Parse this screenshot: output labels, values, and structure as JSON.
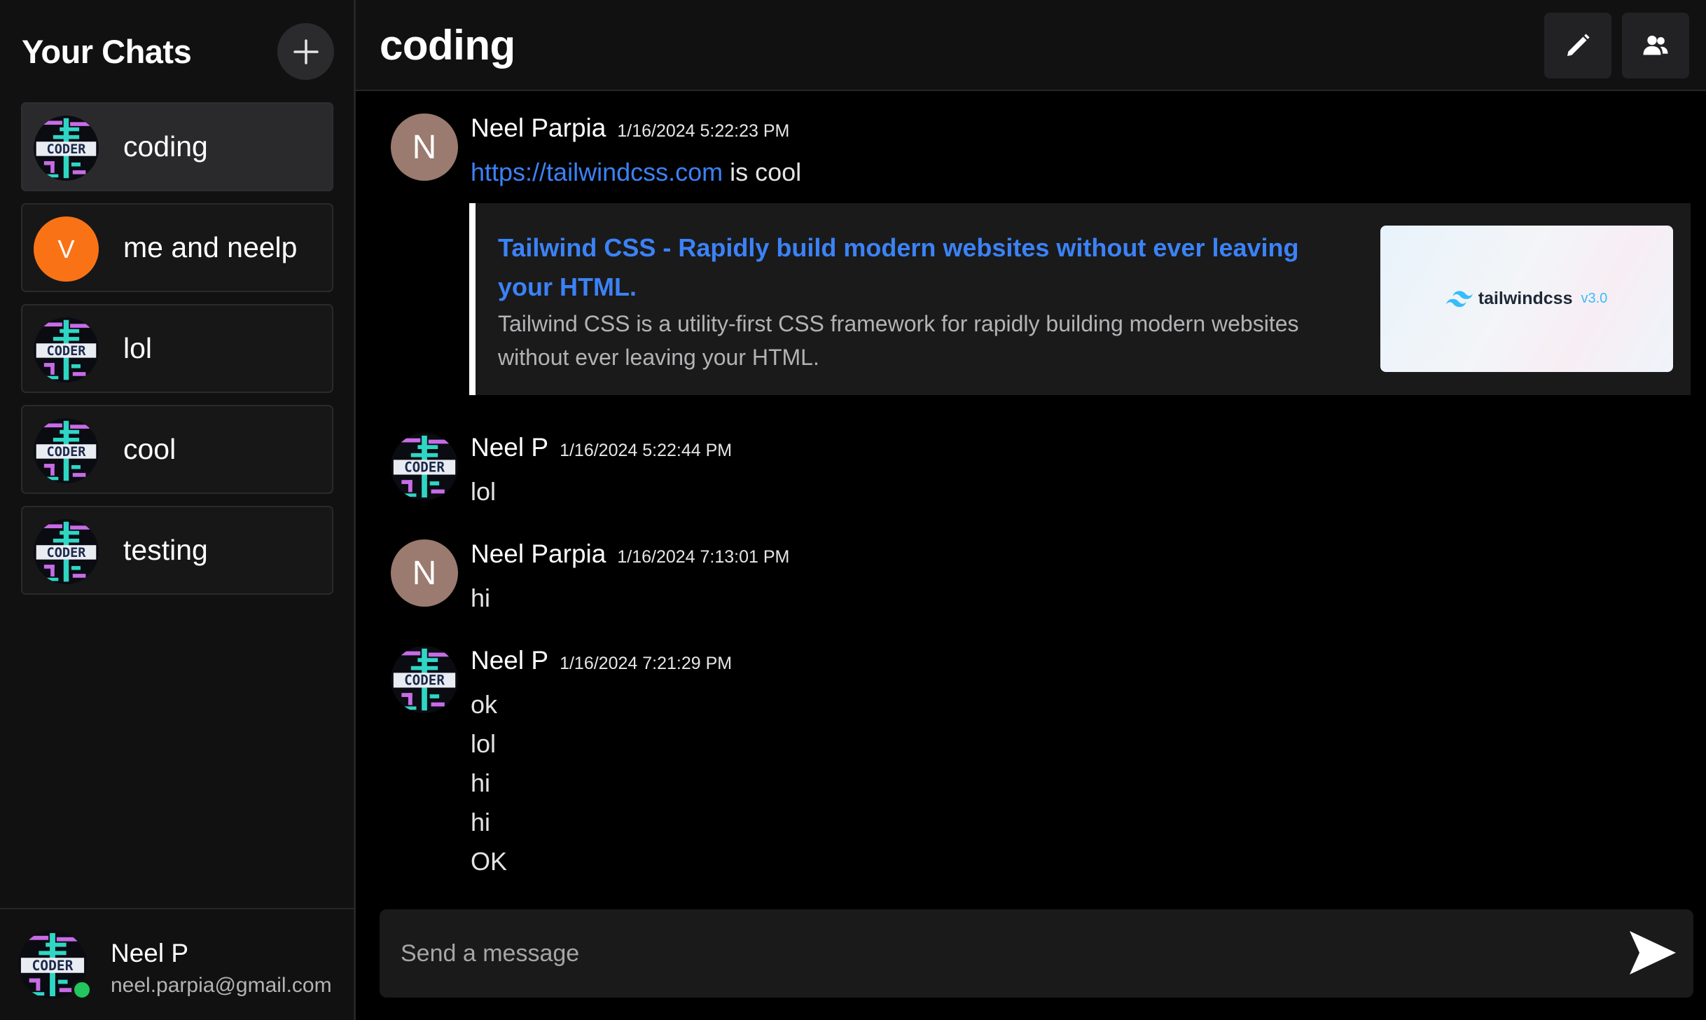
{
  "sidebar": {
    "title": "Your Chats",
    "new_chat_icon": "plus-icon",
    "chats": [
      {
        "name": "coding",
        "avatar": "coder-image",
        "active": true
      },
      {
        "name": "me and neelp",
        "avatar_letter": "V",
        "avatar_color": "#f97316"
      },
      {
        "name": "lol",
        "avatar": "coder-image"
      },
      {
        "name": "cool",
        "avatar": "coder-image"
      },
      {
        "name": "testing",
        "avatar": "coder-image"
      }
    ],
    "user": {
      "name": "Neel P",
      "email": "neel.parpia@gmail.com",
      "status_color": "#22c55e"
    }
  },
  "header": {
    "title": "coding",
    "edit_icon": "pencil-icon",
    "members_icon": "users-icon"
  },
  "messages": [
    {
      "author": "Neel Parpia",
      "avatar_letter": "N",
      "avatar_color": "#9b7a70",
      "timestamp": "1/16/2024 5:22:23 PM",
      "link_text": "https://tailwindcss.com",
      "text_after_link": " is cool",
      "embed": {
        "title": "Tailwind CSS - Rapidly build modern websites without ever leaving your HTML.",
        "description": "Tailwind CSS is a utility-first CSS framework for rapidly building modern websites without ever leaving your HTML.",
        "thumbnail_brand": "tailwindcss",
        "thumbnail_version": "v3.0"
      }
    },
    {
      "author": "Neel P",
      "avatar": "coder-image",
      "timestamp": "1/16/2024 5:22:44 PM",
      "lines": [
        "lol"
      ]
    },
    {
      "author": "Neel Parpia",
      "avatar_letter": "N",
      "avatar_color": "#9b7a70",
      "timestamp": "1/16/2024 7:13:01 PM",
      "lines": [
        "hi"
      ]
    },
    {
      "author": "Neel P",
      "avatar": "coder-image",
      "timestamp": "1/16/2024 7:21:29 PM",
      "lines": [
        "ok",
        "lol",
        "hi",
        "hi",
        "OK"
      ]
    }
  ],
  "composer": {
    "placeholder": "Send a message",
    "send_icon": "send-icon"
  },
  "colors": {
    "link": "#3b82f6",
    "sidebar_bg": "#111112",
    "accent_orange": "#f97316"
  }
}
